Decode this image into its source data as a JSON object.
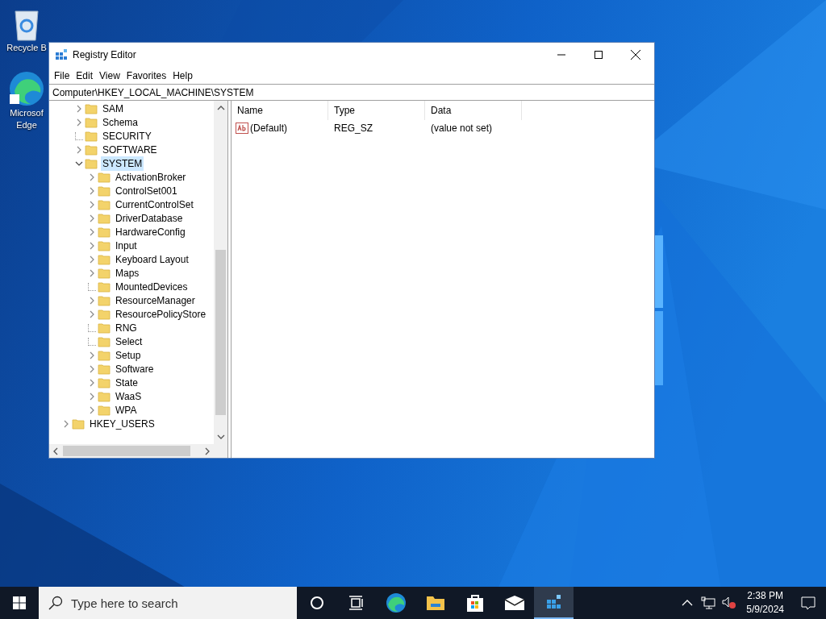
{
  "desktop_icons": [
    {
      "kind": "recycle-bin",
      "lines": [
        "Recycle B"
      ]
    },
    {
      "kind": "edge",
      "lines": [
        "Microsof",
        "Edge"
      ]
    }
  ],
  "window": {
    "title": "Registry Editor",
    "menu": [
      "File",
      "Edit",
      "View",
      "Favorites",
      "Help"
    ],
    "address": "Computer\\HKEY_LOCAL_MACHINE\\SYSTEM",
    "tree": {
      "visible_branch": [
        {
          "label": "SAM",
          "has_children": true,
          "selected": false
        },
        {
          "label": "Schema",
          "has_children": true,
          "selected": false
        },
        {
          "label": "SECURITY",
          "has_children": false,
          "selected": false
        },
        {
          "label": "SOFTWARE",
          "has_children": true,
          "selected": false
        },
        {
          "label": "SYSTEM",
          "has_children": true,
          "selected": true,
          "children": [
            {
              "label": "ActivationBroker",
              "has_children": true,
              "selected": false
            },
            {
              "label": "ControlSet001",
              "has_children": true,
              "selected": false
            },
            {
              "label": "CurrentControlSet",
              "has_children": true,
              "selected": false
            },
            {
              "label": "DriverDatabase",
              "has_children": true,
              "selected": false
            },
            {
              "label": "HardwareConfig",
              "has_children": true,
              "selected": false
            },
            {
              "label": "Input",
              "has_children": true,
              "selected": false
            },
            {
              "label": "Keyboard Layout",
              "has_children": true,
              "selected": false
            },
            {
              "label": "Maps",
              "has_children": true,
              "selected": false
            },
            {
              "label": "MountedDevices",
              "has_children": false,
              "selected": false
            },
            {
              "label": "ResourceManager",
              "has_children": true,
              "selected": false
            },
            {
              "label": "ResourcePolicyStore",
              "has_children": true,
              "selected": false
            },
            {
              "label": "RNG",
              "has_children": false,
              "selected": false
            },
            {
              "label": "Select",
              "has_children": false,
              "selected": false
            },
            {
              "label": "Setup",
              "has_children": true,
              "selected": false
            },
            {
              "label": "Software",
              "has_children": true,
              "selected": false
            },
            {
              "label": "State",
              "has_children": true,
              "selected": false
            },
            {
              "label": "WaaS",
              "has_children": true,
              "selected": false
            },
            {
              "label": "WPA",
              "has_children": true,
              "selected": false
            }
          ]
        }
      ],
      "next_roots": [
        {
          "label": "HKEY_USERS",
          "has_children": true,
          "selected": false
        }
      ]
    },
    "values": {
      "columns": [
        "Name",
        "Type",
        "Data"
      ],
      "rows": [
        {
          "kind": "string",
          "name": "(Default)",
          "type": "REG_SZ",
          "data": "(value not set)"
        }
      ]
    }
  },
  "taskbar": {
    "search": {
      "placeholder": "Type here to search"
    },
    "apps": [
      {
        "kind": "cortana",
        "selected": false
      },
      {
        "kind": "task-view",
        "selected": false
      },
      {
        "kind": "edge",
        "selected": false
      },
      {
        "kind": "folder",
        "selected": false
      },
      {
        "kind": "store",
        "selected": false
      },
      {
        "kind": "mail",
        "selected": false
      },
      {
        "kind": "registry",
        "selected": true
      }
    ],
    "time": "2:38 PM",
    "date": "5/9/2024"
  }
}
